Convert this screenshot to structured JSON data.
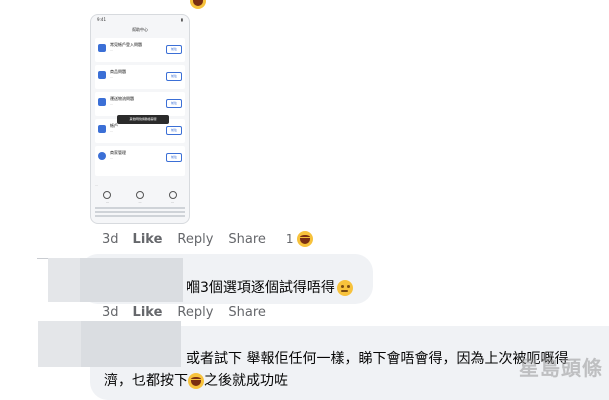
{
  "post_image": {
    "phone_status_left": "9:41",
    "phone_title": "幫助中心",
    "rows": [
      {
        "title": "常見帳戶登入問題",
        "sub": "…",
        "button": "前往"
      },
      {
        "title": "商品問題",
        "sub": "…",
        "button": "前往"
      },
      {
        "title": "運送物流問題",
        "sub": "…",
        "button": "前往"
      },
      {
        "title": "帳戶",
        "sub": "…",
        "button": "前往"
      },
      {
        "title": "商家管理",
        "sub": "…",
        "button": "前往"
      }
    ],
    "tooltip": "其他問題請聯絡客服",
    "footer_note": "…",
    "actions": [
      "…",
      "…",
      "…"
    ]
  },
  "comment1_meta": {
    "time": "3d",
    "like": "Like",
    "reply": "Reply",
    "share": "Share",
    "reaction_count": "1",
    "reaction_icon": "laughing-emoji"
  },
  "comment2": {
    "text": "嗰3個選項逐個試得唔得",
    "emoji": "wink-emoji",
    "meta": {
      "time": "3d",
      "like": "Like",
      "reply": "Reply",
      "share": "Share"
    }
  },
  "comment3": {
    "line1": "或者試下 舉報佢任何一樣，睇下會唔會得，因為上次被呃嘅得",
    "line2_before": "濟，乜都按下",
    "line2_after": "之後就成功咗",
    "emoji": "laughing-emoji"
  },
  "watermark": "星島頭條",
  "colors": {
    "meta_text": "#65676b",
    "bubble_bg": "#f0f2f5",
    "text": "#050505"
  }
}
